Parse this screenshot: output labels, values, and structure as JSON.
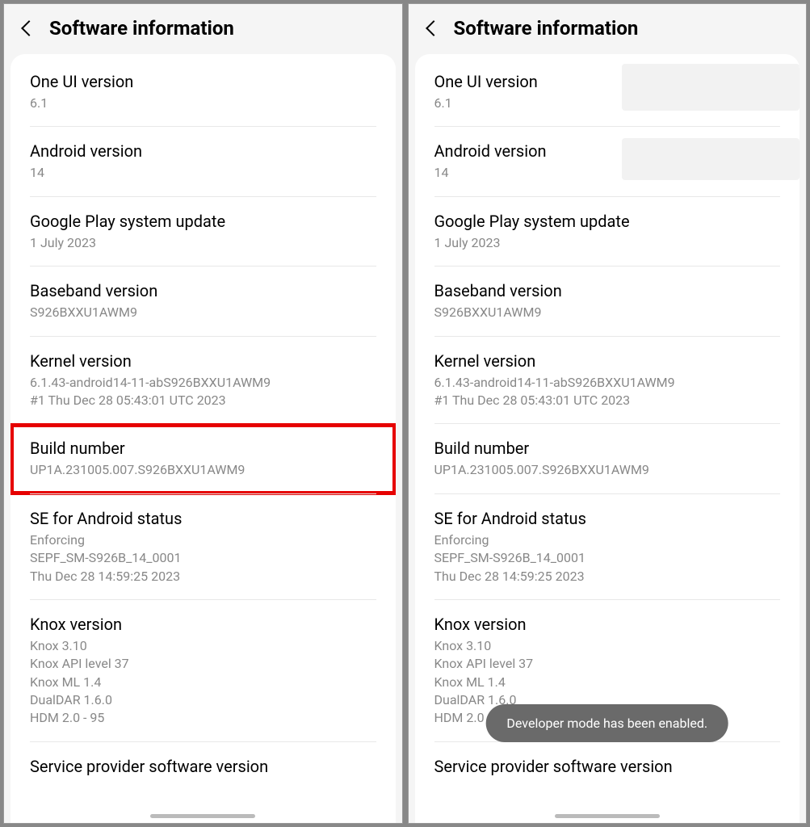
{
  "page_title": "Software information",
  "items": {
    "one_ui": {
      "label": "One UI version",
      "value": "6.1"
    },
    "android": {
      "label": "Android version",
      "value": "14"
    },
    "play_update": {
      "label": "Google Play system update",
      "value": "1 July 2023"
    },
    "baseband": {
      "label": "Baseband version",
      "value": "S926BXXU1AWM9"
    },
    "kernel": {
      "label": "Kernel version",
      "value": "6.1.43-android14-11-abS926BXXU1AWM9\n#1 Thu Dec 28 05:43:01 UTC 2023"
    },
    "build": {
      "label": "Build number",
      "value": "UP1A.231005.007.S926BXXU1AWM9"
    },
    "se_status": {
      "label": "SE for Android status",
      "value": "Enforcing\nSEPF_SM-S926B_14_0001\nThu Dec 28 14:59:25 2023"
    },
    "knox": {
      "label": "Knox version",
      "value": "Knox 3.10\nKnox API level 37\nKnox ML 1.4\nDualDAR 1.6.0\nHDM 2.0 - 95"
    },
    "service_provider": {
      "label": "Service provider software version"
    }
  },
  "toast_message": "Developer mode has been enabled."
}
